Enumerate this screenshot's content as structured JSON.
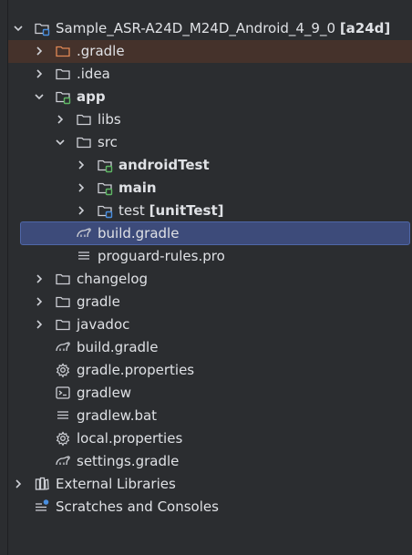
{
  "colors": {
    "background": "#2b2d30",
    "selection": "#3d4b7a",
    "excluded_row": "#45322b",
    "folder_stroke": "#ced0d6",
    "excluded_folder": "#e08855",
    "module_badge": "#4a8fe0",
    "source_badge": "#5fb865"
  },
  "tree": {
    "root": {
      "name": "Sample_ASR-A24D_M24D_Android_4_9_0",
      "tag": "[a24d]",
      "icon": "module-folder-icon"
    },
    "items": [
      {
        "label": ".gradle",
        "icon": "excluded-folder-icon"
      },
      {
        "label": ".idea",
        "icon": "folder-icon"
      },
      {
        "label": "app",
        "icon": "module-folder-icon"
      },
      {
        "label": "libs",
        "icon": "folder-icon"
      },
      {
        "label": "src",
        "icon": "folder-icon"
      },
      {
        "label": "androidTest",
        "icon": "test-source-folder-icon"
      },
      {
        "label": "main",
        "icon": "source-folder-icon"
      },
      {
        "label": "test",
        "tag": "[unitTest]",
        "icon": "test-folder-icon"
      },
      {
        "label": "build.gradle",
        "icon": "gradle-icon"
      },
      {
        "label": "proguard-rules.pro",
        "icon": "text-file-icon"
      },
      {
        "label": "changelog",
        "icon": "folder-icon"
      },
      {
        "label": "gradle",
        "icon": "folder-icon"
      },
      {
        "label": "javadoc",
        "icon": "folder-icon"
      },
      {
        "label": "build.gradle",
        "icon": "gradle-icon"
      },
      {
        "label": "gradle.properties",
        "icon": "settings-file-icon"
      },
      {
        "label": "gradlew",
        "icon": "terminal-file-icon"
      },
      {
        "label": "gradlew.bat",
        "icon": "text-file-icon"
      },
      {
        "label": "local.properties",
        "icon": "settings-file-icon"
      },
      {
        "label": "settings.gradle",
        "icon": "gradle-icon"
      },
      {
        "label": "External Libraries",
        "icon": "libraries-icon"
      },
      {
        "label": "Scratches and Consoles",
        "icon": "scratches-icon"
      }
    ]
  }
}
